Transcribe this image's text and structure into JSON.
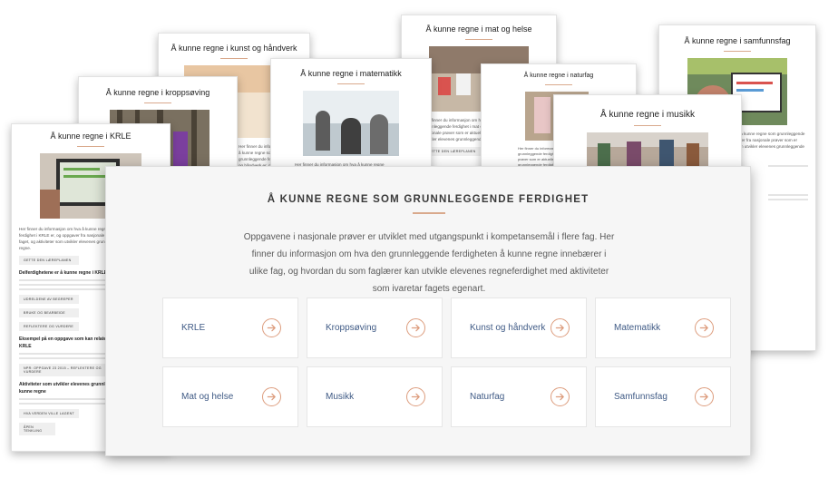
{
  "cards": {
    "krle": {
      "title": "Å kunne regne i KRLE",
      "intro": "Her finner du informasjon om hva å kunne regne som grunnleggende ferdighet i KRLE er, og oppgaver fra nasjonale prøver som er aktuelle for faget, og aktiviteter som utvikler elevenes grunnleggende ferdighet i å kunne regne.",
      "btn1": "GETTE DEN LÆREPLANEN",
      "sub1": "Delferdighetene er å kunne regne i KRLE",
      "btn2": "UDRELDENE AV BEGREPER",
      "btn3": "BRUKE OG BEARBEIDE",
      "btn4": "REFLEKTERE OG VURDERE",
      "sub2": "Eksempel på en oppgave som kan relateres til kompetansemål i KRLE",
      "btn5": "NPR: OPPGAVE 23 2015 – REFLEKTERE OG VURDERE",
      "sub3": "Aktiviteter som utvikler elevenes grunnleggende ferdighet i å kunne regne",
      "btn6": "HVA VERDEN VILLE LAGENT",
      "btn7": "ÅPEN TENKLING"
    },
    "kroppsoving": {
      "title": "Å kunne regne i kroppsøving"
    },
    "kunst": {
      "title": "Å kunne regne i kunst og håndverk",
      "intro": "Her finner du informasjon om hva å kunne regne som grunnleggende ferdighet i kunst og håndverk er, og oppgaver fra nasjonale prøver som er aktuelle for faget."
    },
    "matematikk": {
      "title": "Å kunne regne i matematikk",
      "intro": "Her finner du informasjon om hva å kunne regne"
    },
    "mat_og_helse": {
      "title": "Å kunne regne i mat og helse",
      "intro": "Her finner du informasjon om hva å kunne regne som grunnleggende ferdighet i mat og helse er, og oppgaver fra nasjonale prøver som er aktuelle for faget, og aktiviteter som utvikler elevenes grunnleggende ferdighet i å kunne regne.",
      "btn1": "GETTE DEN LÆREPLANEN"
    },
    "naturfag": {
      "title": "Å kunne regne i naturfag",
      "intro": "Her finner du informasjon om hva å kunne regne som grunnleggende ferdighet i naturfag er, og oppgaver fra nasjonale prøver som er aktuelle for faget, og aktiviteter som utvikler elevenes grunnleggende ferdighet."
    },
    "musikk": {
      "title": "Å kunne regne i musikk"
    },
    "samfunnsfag": {
      "title": "Å kunne regne i samfunnsfag",
      "intro": "Her finner du informasjon om hva å kunne regne som grunnleggende ferdighet i samfunnsfag er, oppgaver fra nasjonale prøver som er aktuelle for faget, og aktiviteter som utvikler elevenes grunnleggende ferdighet i å kunne regne."
    }
  },
  "main": {
    "title": "Å KUNNE REGNE SOM GRUNNLEGGENDE FERDIGHET",
    "intro": "Oppgavene i nasjonale prøver er utviklet med utgangspunkt i kompetansemål i flere fag. Her finner du informasjon om hva den grunnleggende ferdigheten å kunne regne innebærer i ulike fag, og hvordan du som faglærer kan utvikle elevenes regneferdighet med aktiviteter som ivaretar fagets egenart.",
    "tiles": [
      {
        "label": "KRLE"
      },
      {
        "label": "Kroppsøving"
      },
      {
        "label": "Kunst og håndverk"
      },
      {
        "label": "Matematikk"
      },
      {
        "label": "Mat og helse"
      },
      {
        "label": "Musikk"
      },
      {
        "label": "Naturfag"
      },
      {
        "label": "Samfunnsfag"
      }
    ]
  },
  "colors": {
    "accent": "#dd9d7e",
    "link": "#3f5a85",
    "panel_bg": "#f6f6f6"
  },
  "icons": {
    "tile_arrow": "arrow-right-circle-icon"
  }
}
